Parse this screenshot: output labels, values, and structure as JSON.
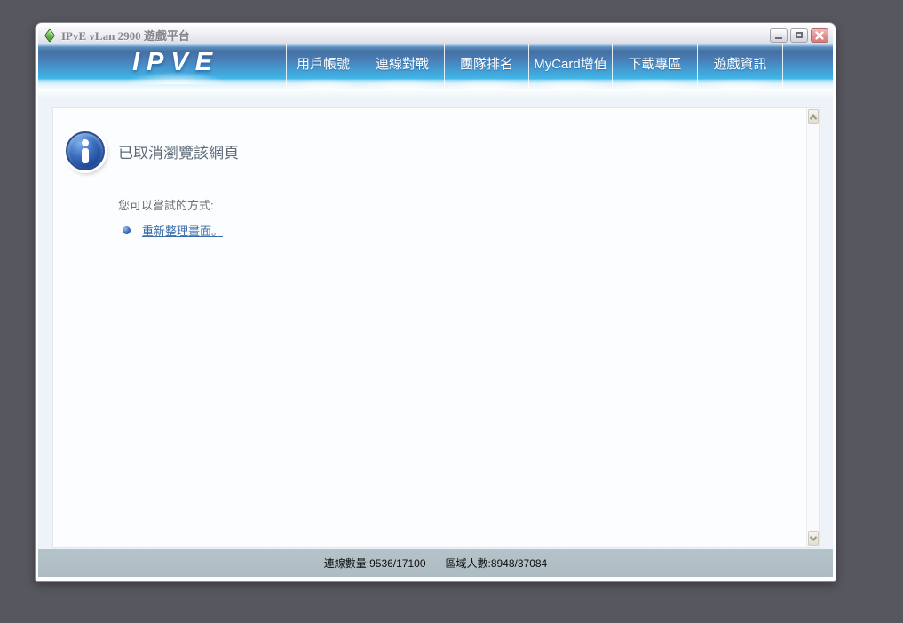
{
  "window": {
    "title": "IPvE vLan 2900 遊戲平台"
  },
  "navbar": {
    "logo": "IPVE",
    "items": [
      {
        "label": "用戶帳號"
      },
      {
        "label": "連線對戰"
      },
      {
        "label": "團隊排名"
      },
      {
        "label": "MyCard增值"
      },
      {
        "label": "下載專區"
      },
      {
        "label": "遊戲資訊"
      }
    ]
  },
  "content": {
    "heading": "已取消瀏覽該網頁",
    "tip_intro": "您可以嘗試的方式:",
    "refresh_link": "重新整理畫面。"
  },
  "statusbar": {
    "connections": "連線數量:9536/17100",
    "region": "區域人數:8948/37084"
  },
  "icons": {
    "app_icon": "green-gem-diamond",
    "info_icon": "blue-circle-lowercase-i",
    "minimize_icon": "horizontal-bar",
    "maximize_icon": "hollow-square",
    "close_icon": "white-x",
    "bullet_icon": "blue-glossy-sphere",
    "scroll_up_icon": "chevron-up",
    "scroll_down_icon": "chevron-down"
  },
  "colors": {
    "page_bg": "#57575f",
    "nav_blue_top": "#4a7db8",
    "nav_blue_bottom": "#41b7e8",
    "close_button_red": "#d47e7e",
    "status_bg": "#aebcc3",
    "link_blue": "#3a6ca8",
    "heading_gray_blue": "#5d6b77"
  }
}
